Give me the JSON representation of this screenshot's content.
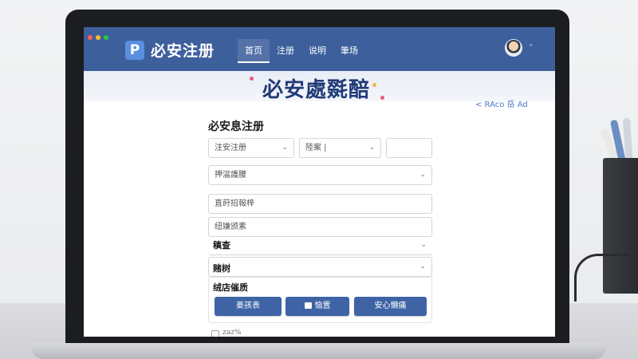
{
  "app": {
    "logo_glyph": "P",
    "brand": "必安注册"
  },
  "nav": {
    "tabs": [
      {
        "label": "首页",
        "active": true
      },
      {
        "label": "注册",
        "active": false
      },
      {
        "label": "说明",
        "active": false
      },
      {
        "label": "筆场",
        "active": false
      }
    ],
    "user_caret": "ᵛ"
  },
  "banner": {
    "title": "必安處毲醅",
    "lang_link": "< RAco 岳 Ad"
  },
  "form": {
    "title": "必安息注册",
    "row1": [
      {
        "placeholder": "注安注册",
        "has_caret": true
      },
      {
        "placeholder": "陸案 |",
        "has_caret": true
      },
      {
        "placeholder": "",
        "has_caret": false
      }
    ],
    "select1": {
      "value": "押湓護腰"
    },
    "input2": {
      "placeholder": "直莳招報梓"
    },
    "input3": {
      "placeholder": "纽嫌颁素"
    },
    "label_a": "稹查",
    "label_b": "赌树",
    "section_label": "绒店催质",
    "buttons": [
      {
        "label": "姜孩表",
        "icon": null
      },
      {
        "label": "恼置",
        "icon": "check-box-icon"
      },
      {
        "label": "安心懒痛",
        "icon": null
      }
    ],
    "checkbox_label": "zaz%"
  },
  "colors": {
    "nav_bg": "#3d5f9c",
    "accent": "#3e64a6",
    "link": "#4f79c4"
  }
}
